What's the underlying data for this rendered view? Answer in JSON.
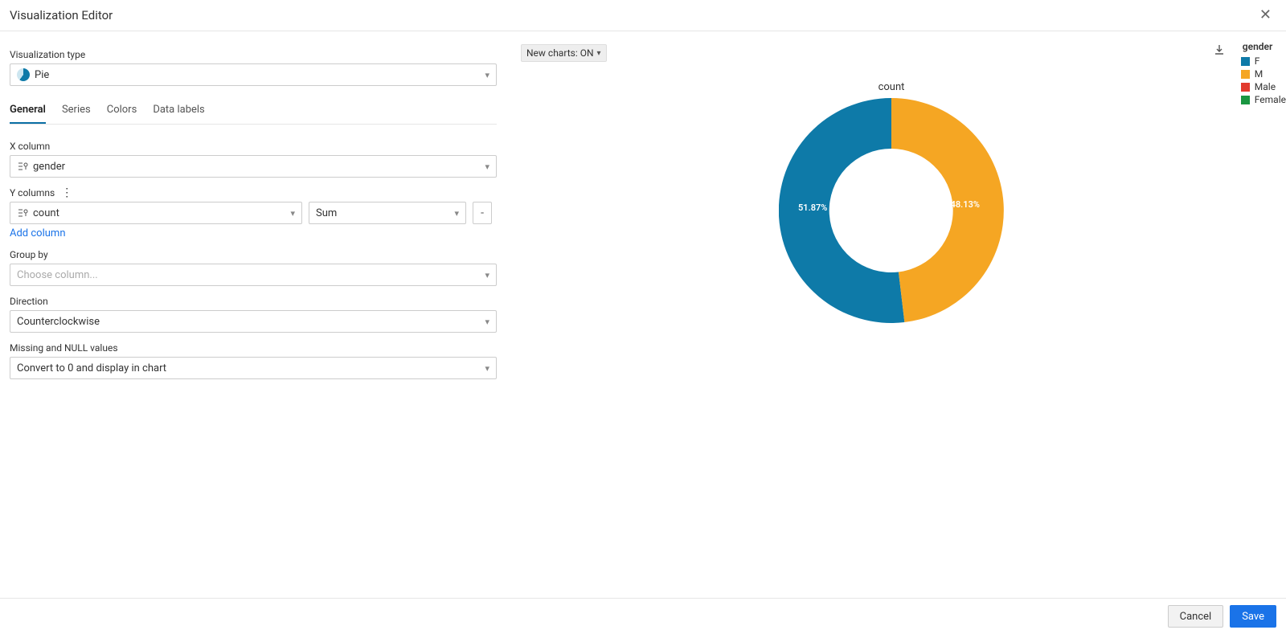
{
  "header": {
    "title": "Visualization Editor"
  },
  "viz_type": {
    "label": "Visualization type",
    "value": "Pie"
  },
  "tabs": [
    {
      "label": "General",
      "active": true
    },
    {
      "label": "Series",
      "active": false
    },
    {
      "label": "Colors",
      "active": false
    },
    {
      "label": "Data labels",
      "active": false
    }
  ],
  "xcol": {
    "label": "X column",
    "value": "gender"
  },
  "ycols": {
    "label": "Y columns",
    "rows": [
      {
        "value": "count",
        "agg": "Sum"
      }
    ],
    "add_link": "Add column"
  },
  "groupby": {
    "label": "Group by",
    "placeholder": "Choose column..."
  },
  "direction": {
    "label": "Direction",
    "value": "Counterclockwise"
  },
  "missing": {
    "label": "Missing and NULL values",
    "value": "Convert to 0 and display in chart"
  },
  "toggle": {
    "label": "New charts: ON"
  },
  "chart": {
    "title": "count",
    "legend_title": "gender",
    "legend": [
      {
        "label": "F",
        "color": "#0e7aa8"
      },
      {
        "label": "M",
        "color": "#f5a623"
      },
      {
        "label": "Male",
        "color": "#e23b2e"
      },
      {
        "label": "Female",
        "color": "#1a9641"
      }
    ],
    "slice_labels": {
      "a": "51.87%",
      "b": "48.13%"
    }
  },
  "footer": {
    "cancel": "Cancel",
    "save": "Save"
  },
  "chart_data": {
    "type": "pie",
    "title": "count",
    "categories": [
      "F",
      "M",
      "Male",
      "Female"
    ],
    "values": [
      51.87,
      48.13,
      0,
      0
    ],
    "colors": [
      "#0e7aa8",
      "#f5a623",
      "#e23b2e",
      "#1a9641"
    ],
    "donut_inner_radius_ratio": 0.55,
    "direction": "counterclockwise",
    "label_format": "percent"
  }
}
